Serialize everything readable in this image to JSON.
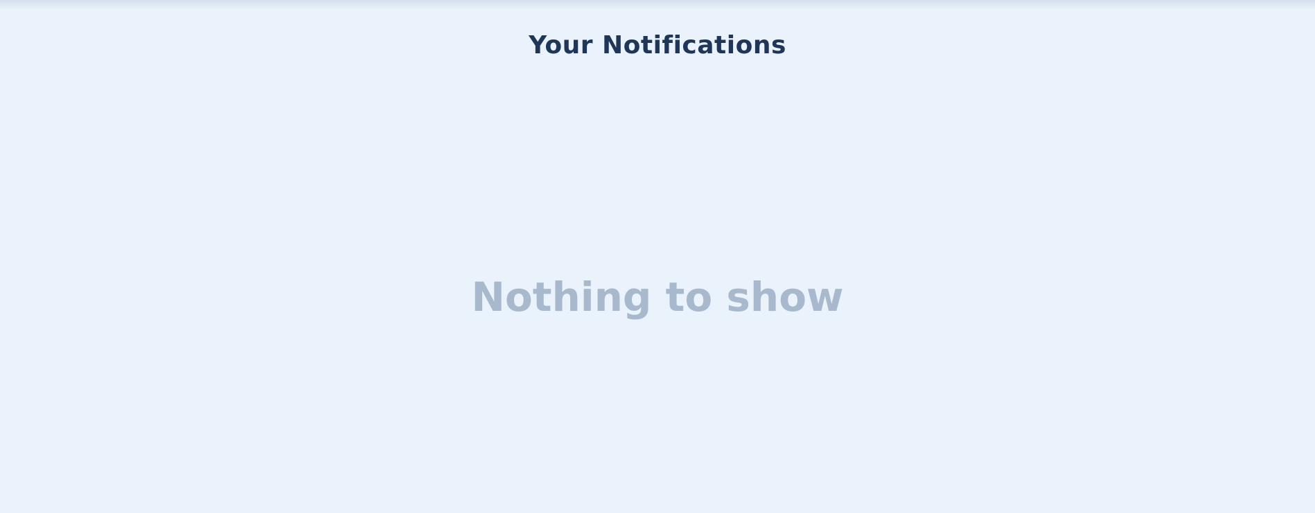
{
  "header": {
    "title": "Your Notifications"
  },
  "main": {
    "empty_message": "Nothing to show"
  },
  "colors": {
    "background": "#eaf2fb",
    "title": "#1f3658",
    "empty_text": "#a9b9cd"
  }
}
